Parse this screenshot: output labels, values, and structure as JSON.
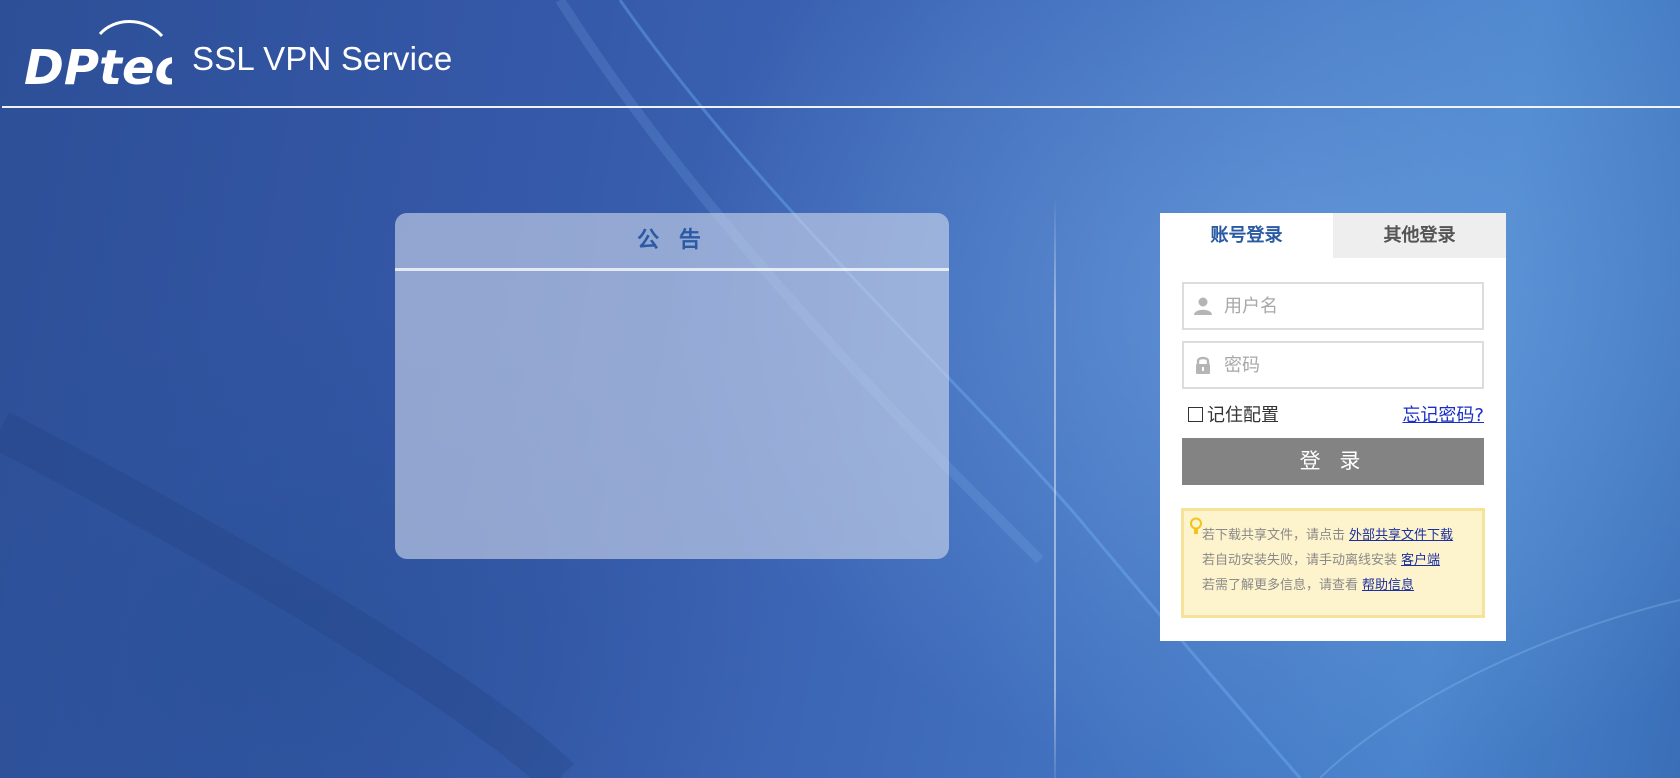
{
  "header": {
    "logo_text": "DPtech",
    "title": "SSL VPN Service"
  },
  "notice": {
    "title": "公 告"
  },
  "login": {
    "tabs": [
      {
        "label": "账号登录",
        "active": true
      },
      {
        "label": "其他登录",
        "active": false
      }
    ],
    "username": {
      "placeholder": "用户名",
      "value": "",
      "icon": "user-icon"
    },
    "password": {
      "placeholder": "密码",
      "value": "",
      "icon": "lock-icon"
    },
    "remember_label": "记住配置",
    "remember_checked": false,
    "forgot_label": "忘记密码?",
    "submit_label": "登 录"
  },
  "tips": {
    "icon": "lightbulb-icon",
    "lines": [
      {
        "text": "若下载共享文件，请点击",
        "link": "外部共享文件下载"
      },
      {
        "text": "若自动安装失败，请手动离线安装",
        "link": "客户端"
      },
      {
        "text": "若需了解更多信息，请查看",
        "link": "帮助信息"
      }
    ]
  },
  "colors": {
    "accent": "#2a5aa3",
    "button": "#838383",
    "link": "#1a2fc8",
    "tip_bg": "#fdf3cc"
  }
}
